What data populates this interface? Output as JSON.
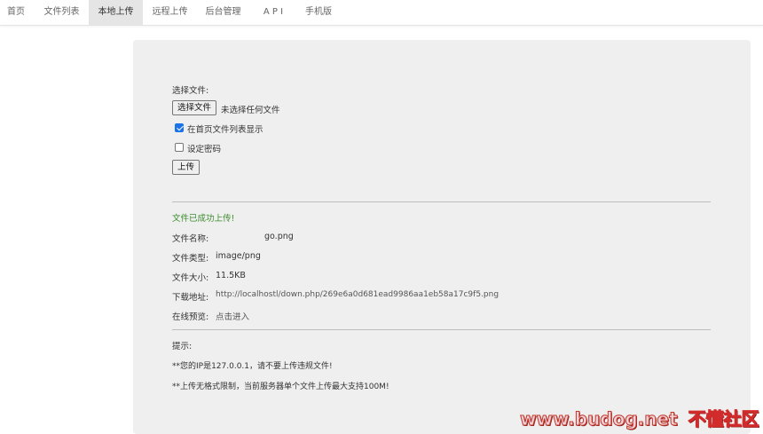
{
  "nav": {
    "items": [
      {
        "label": "首页",
        "active": false
      },
      {
        "label": "文件列表",
        "active": false
      },
      {
        "label": "本地上传",
        "active": true
      },
      {
        "label": "远程上传",
        "active": false
      },
      {
        "label": "后台管理",
        "active": false
      },
      {
        "label": "A P I",
        "active": false
      },
      {
        "label": "手机版",
        "active": false
      }
    ]
  },
  "form": {
    "choose_label": "选择文件:",
    "file_button": "选择文件",
    "no_file_text": "未选择任何文件",
    "show_on_home_label": "在首页文件列表显示",
    "show_on_home_checked": true,
    "password_label": "设定密码",
    "password_checked": false,
    "upload_button": "上传"
  },
  "result": {
    "success_message": "文件已成功上传!",
    "name_label": "文件名称:",
    "name_value": "go.png",
    "type_label": "文件类型:",
    "type_value": "image/png",
    "size_label": "文件大小:",
    "size_value": "11.5KB",
    "url_label": "下载地址:",
    "url_value": "http://localhostl/down.php/269e6a0d681ead9986aa1eb58a17c9f5.png",
    "preview_label": "在线预览:",
    "preview_link": "点击进入"
  },
  "tips": {
    "title": "提示:",
    "line1": "**您的IP是127.0.0.1，请不要上传违规文件!",
    "line2": "**上传无格式限制，当前服务器单个文件上传最大支持100M!"
  },
  "watermark": {
    "domain": "www.budog.net",
    "name": "不懂社区"
  },
  "colors": {
    "success": "#3c8c2e",
    "checkbox": "#1a73e8",
    "panel": "#efefef",
    "nav_active": "#e5e5e5"
  }
}
